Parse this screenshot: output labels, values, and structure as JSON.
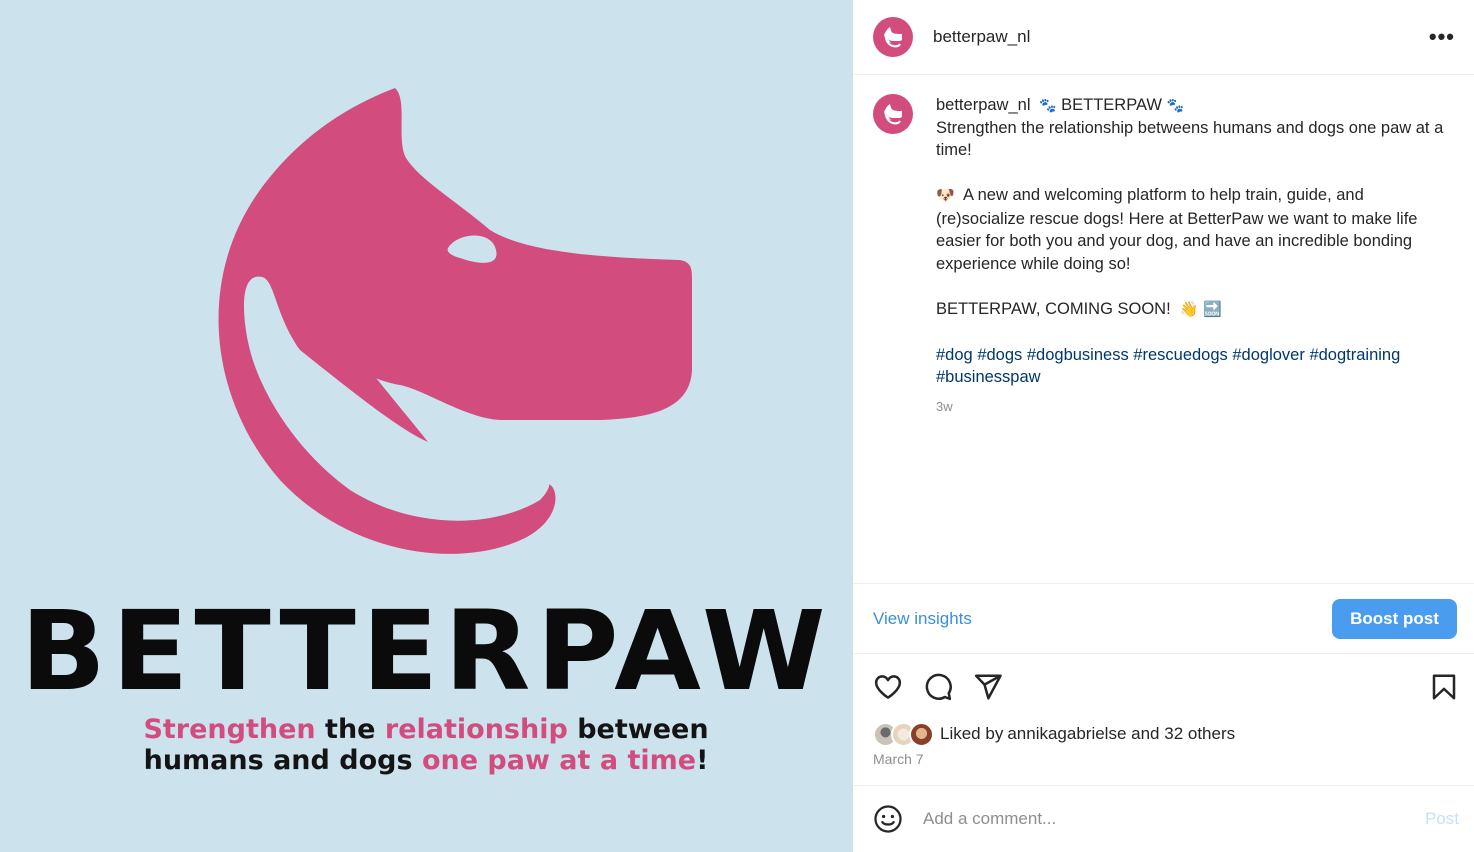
{
  "media": {
    "brand": "BETTERPAW",
    "tagline_line1": [
      {
        "text": "Strengthen",
        "pink": true
      },
      {
        "text": " the ",
        "pink": false
      },
      {
        "text": "relationship",
        "pink": true
      },
      {
        "text": " between",
        "pink": false
      }
    ],
    "tagline_line2": [
      {
        "text": "humans and dogs ",
        "pink": false
      },
      {
        "text": "one paw at a time",
        "pink": true
      },
      {
        "text": "!",
        "pink": false
      }
    ],
    "colors": {
      "background": "#cce3ee",
      "logo": "#d24c7e",
      "text": "#0b0b0b"
    }
  },
  "header": {
    "username": "betterpaw_nl",
    "more_label": "•••"
  },
  "caption": {
    "username": "betterpaw_nl",
    "title": "BETTERPAW",
    "paw_icon": "🐾",
    "line1": "Strengthen the relationship betweens humans and dogs one paw at a time!",
    "dog_emoji": "🐶",
    "para2": "A new and welcoming platform to help train, guide, and (re)socialize rescue dogs! Here at BetterPaw we want to make life easier for both you and your dog, and have an incredible bonding experience while doing so!",
    "para3": "BETTERPAW, COMING SOON!",
    "wave_emoji": "👋",
    "soon_emoji": "🔜",
    "hashtags": [
      "#dog",
      "#dogs",
      "#dogbusiness",
      "#rescuedogs",
      "#doglover",
      "#dogtraining",
      "#businesspaw"
    ],
    "time": "3w"
  },
  "insights": {
    "view_label": "View insights",
    "boost_label": "Boost post"
  },
  "likes": {
    "prefix": "Liked by ",
    "user": "annikagabrielse",
    "middle": " and ",
    "others": "32 others"
  },
  "date": "March 7",
  "comment": {
    "placeholder": "Add a comment...",
    "post_label": "Post"
  }
}
